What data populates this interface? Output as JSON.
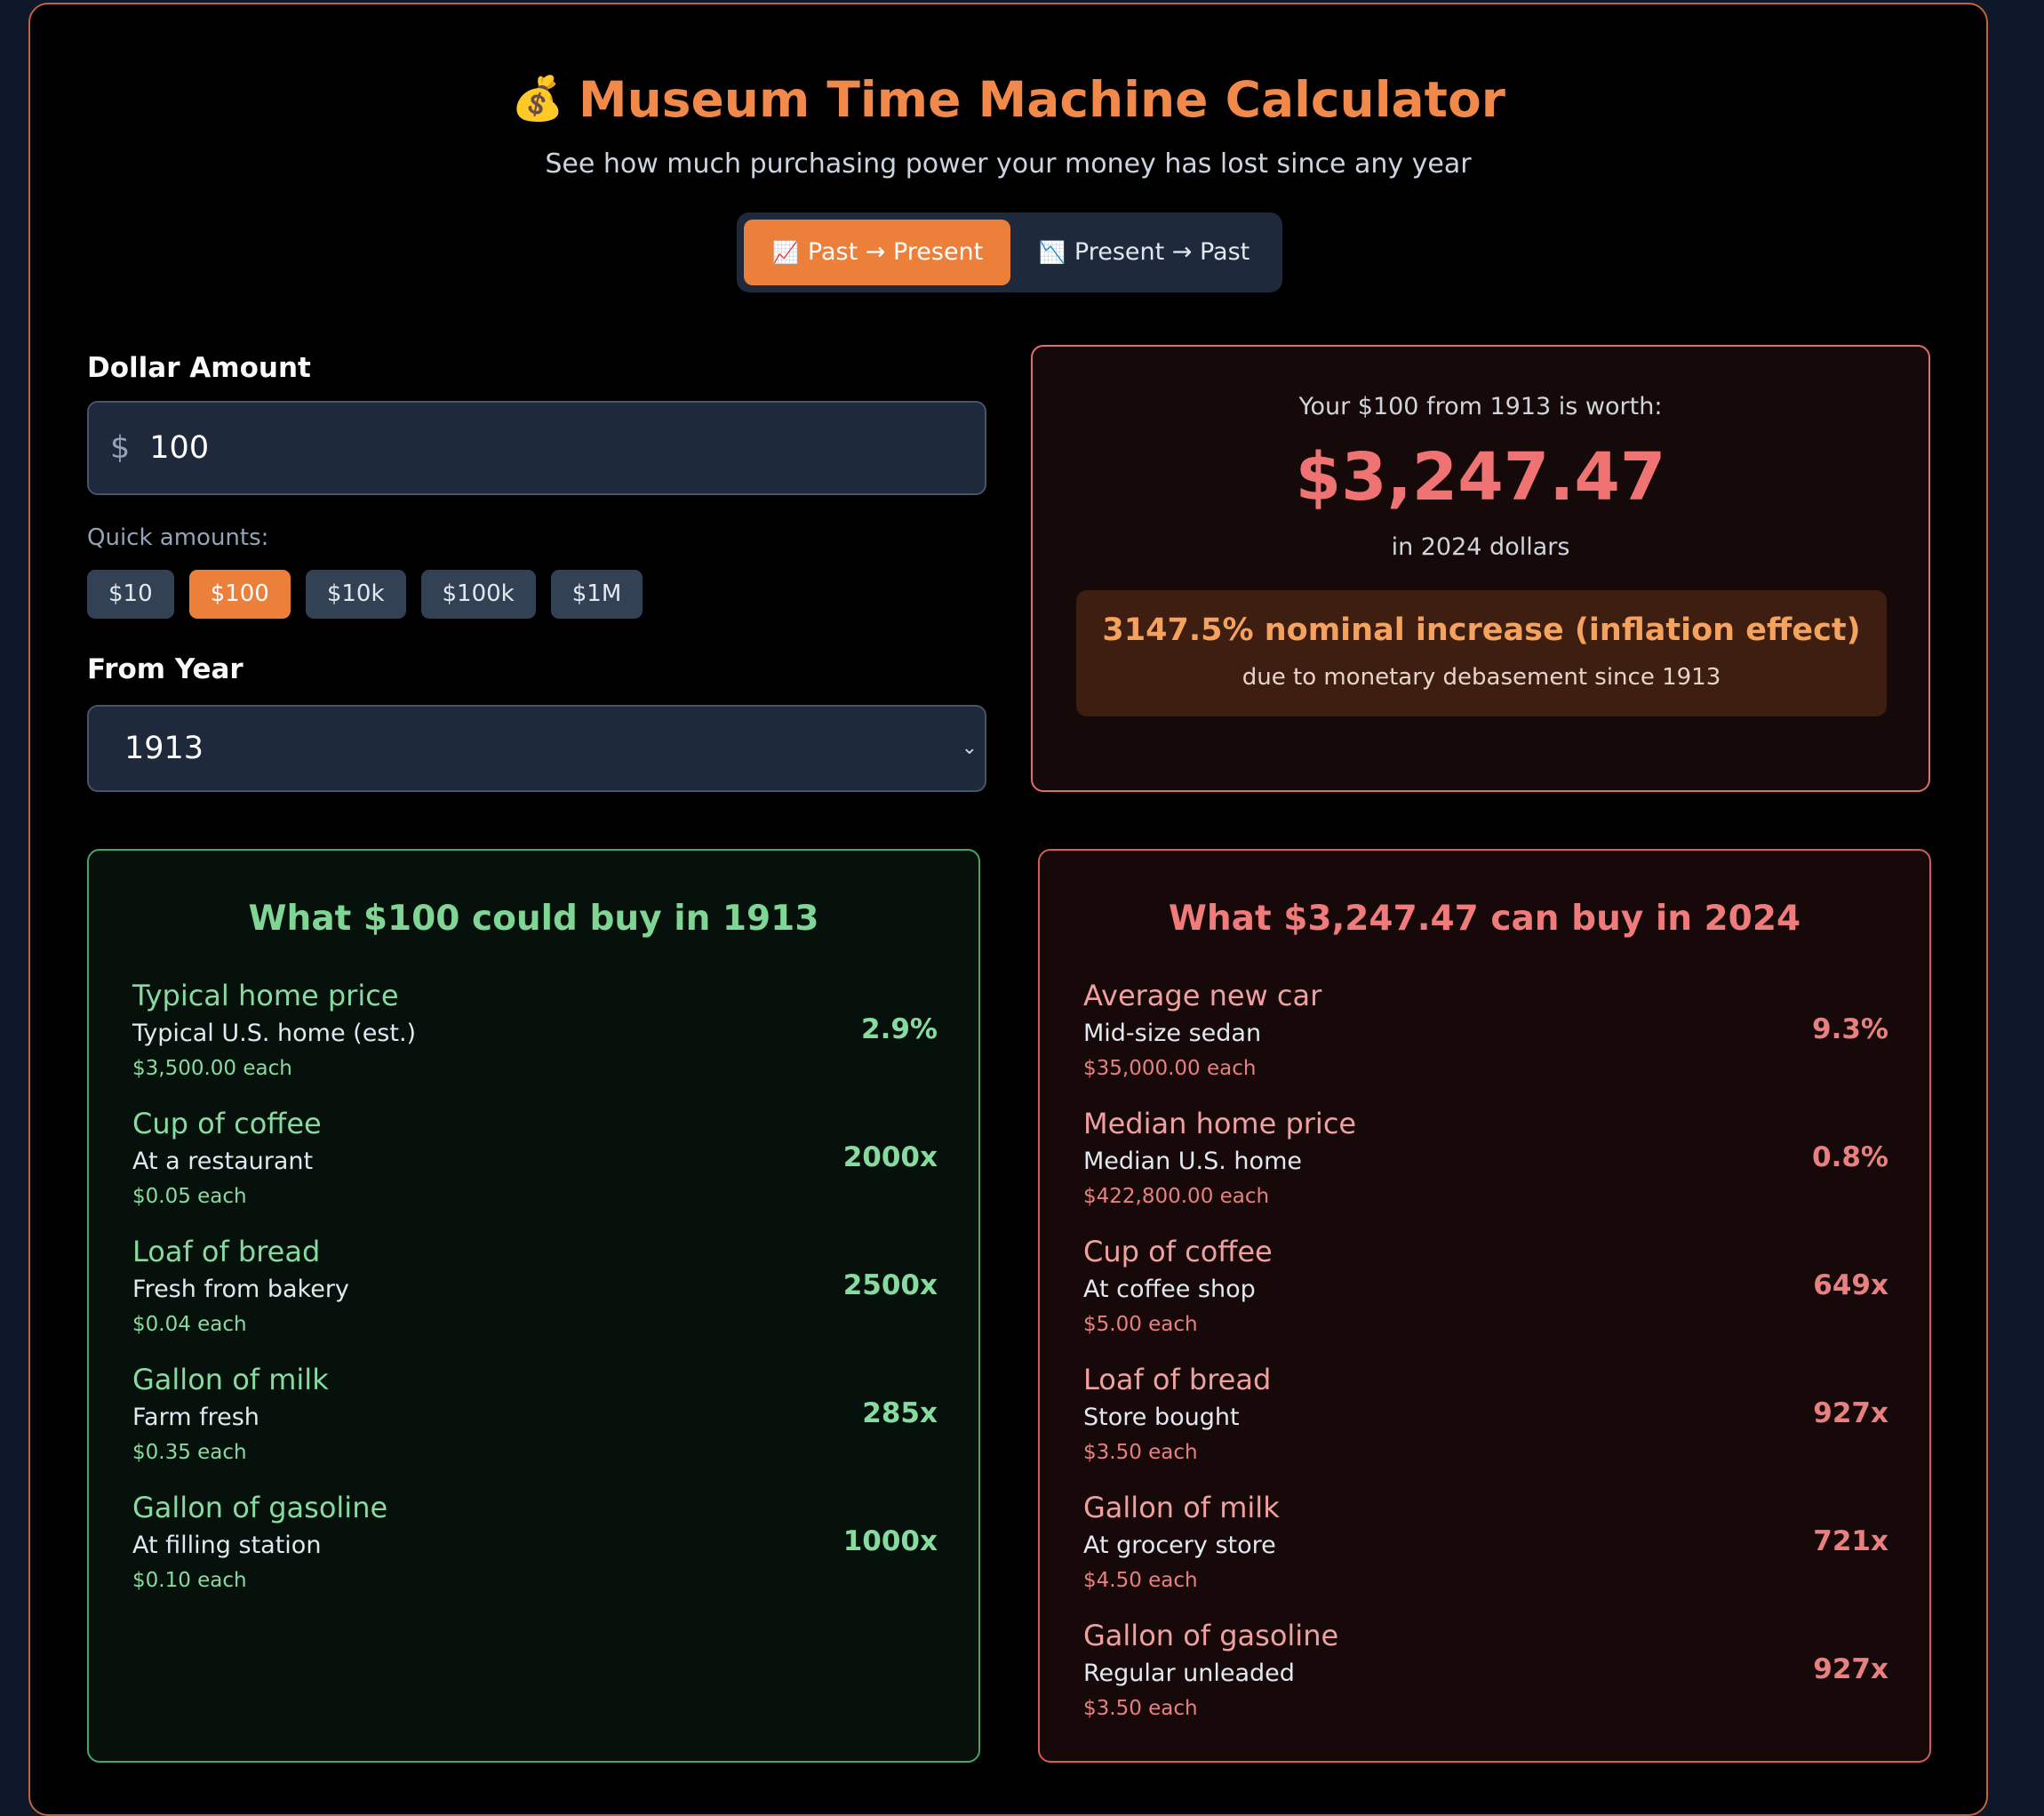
{
  "header": {
    "icon": "money-bag-icon",
    "title": "Museum Time Machine Calculator",
    "subtitle": "See how much purchasing power your money has lost since any year"
  },
  "mode_toggle": {
    "options": [
      {
        "icon": "chart-up-icon",
        "glyph": "📈",
        "label": "Past → Present",
        "active": true
      },
      {
        "icon": "chart-down-icon",
        "glyph": "📉",
        "label": "Present → Past",
        "active": false
      }
    ]
  },
  "form": {
    "amount_label": "Dollar Amount",
    "currency_symbol": "$",
    "amount_value": "100",
    "quick_label": "Quick amounts:",
    "quick_amounts": [
      {
        "label": "$10",
        "active": false
      },
      {
        "label": "$100",
        "active": true
      },
      {
        "label": "$10k",
        "active": false
      },
      {
        "label": "$100k",
        "active": false
      },
      {
        "label": "$1M",
        "active": false
      }
    ],
    "year_label": "From Year",
    "year_value": "1913"
  },
  "result": {
    "intro": "Your $100 from 1913 is worth:",
    "value": "$3,247.47",
    "unit": "in 2024 dollars",
    "increase": "3147.5% nominal increase (inflation effect)",
    "note": "due to monetary debasement since 1913"
  },
  "past_card": {
    "title": "What $100 could buy in 1913",
    "items": [
      {
        "name": "Typical home price",
        "desc": "Typical U.S. home (est.)",
        "price": "$3,500.00 each",
        "qty": "2.9%"
      },
      {
        "name": "Cup of coffee",
        "desc": "At a restaurant",
        "price": "$0.05 each",
        "qty": "2000x"
      },
      {
        "name": "Loaf of bread",
        "desc": "Fresh from bakery",
        "price": "$0.04 each",
        "qty": "2500x"
      },
      {
        "name": "Gallon of milk",
        "desc": "Farm fresh",
        "price": "$0.35 each",
        "qty": "285x"
      },
      {
        "name": "Gallon of gasoline",
        "desc": "At filling station",
        "price": "$0.10 each",
        "qty": "1000x"
      }
    ]
  },
  "present_card": {
    "title": "What $3,247.47 can buy in 2024",
    "items": [
      {
        "name": "Average new car",
        "desc": "Mid-size sedan",
        "price": "$35,000.00 each",
        "qty": "9.3%"
      },
      {
        "name": "Median home price",
        "desc": "Median U.S. home",
        "price": "$422,800.00 each",
        "qty": "0.8%"
      },
      {
        "name": "Cup of coffee",
        "desc": "At coffee shop",
        "price": "$5.00 each",
        "qty": "649x"
      },
      {
        "name": "Loaf of bread",
        "desc": "Store bought",
        "price": "$3.50 each",
        "qty": "927x"
      },
      {
        "name": "Gallon of milk",
        "desc": "At grocery store",
        "price": "$4.50 each",
        "qty": "721x"
      },
      {
        "name": "Gallon of gasoline",
        "desc": "Regular unleaded",
        "price": "$3.50 each",
        "qty": "927x"
      }
    ]
  },
  "colors": {
    "accent": "#ec7f3a",
    "title": "#f0894a",
    "result_red": "#ef7373",
    "past_green": "#86dba0",
    "present_red": "#e88080"
  }
}
